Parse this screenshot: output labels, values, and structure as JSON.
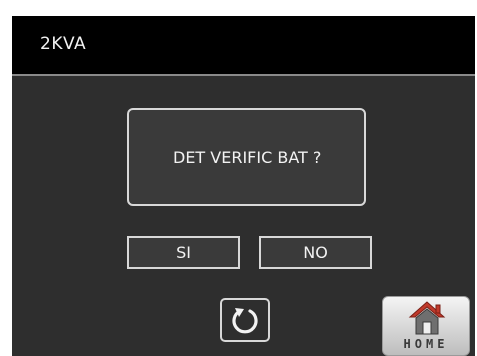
{
  "header": {
    "title": "2KVA"
  },
  "dialog": {
    "message": "DET VERIFIC BAT ?",
    "yes_label": "SI",
    "no_label": "NO"
  },
  "footer": {
    "back_icon": "rotate-back-icon",
    "home_icon": "home-icon",
    "home_label": "HOME"
  },
  "colors": {
    "background": "#2e2e2e",
    "header": "#000000",
    "border": "#d8d8d8",
    "home_roof": "#c0392b"
  }
}
